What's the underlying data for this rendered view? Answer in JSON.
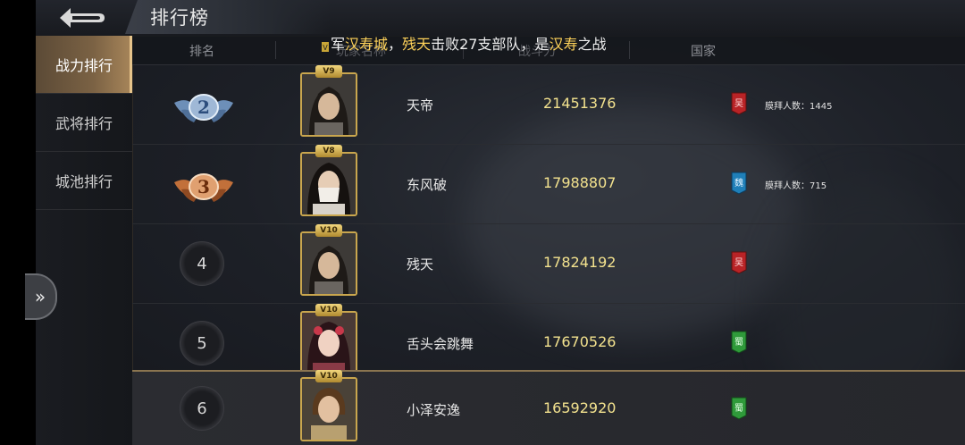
{
  "header": {
    "title": "排行榜"
  },
  "ticker": {
    "badge": "V",
    "p1": "军",
    "h1": "汉寿城",
    "p2": "，",
    "h2": "残天",
    "p3": "击败27支部队，是",
    "h3": "汉寿",
    "p4": "之战"
  },
  "sidebar": {
    "items": [
      {
        "label": "战力排行",
        "active": true
      },
      {
        "label": "武将排行",
        "active": false
      },
      {
        "label": "城池排行",
        "active": false
      }
    ]
  },
  "columns": [
    "排名",
    "玩家名称",
    "战斗力",
    "国家"
  ],
  "rows": [
    {
      "rank": "2",
      "vip": "V9",
      "name": "天帝",
      "power": "21451376",
      "country": "吴",
      "flag_color": "#b82326",
      "worship": "膜拜人数：1445"
    },
    {
      "rank": "3",
      "vip": "V8",
      "name": "东风破",
      "power": "17988807",
      "country": "魏",
      "flag_color": "#1f7fb8",
      "worship": "膜拜人数：715"
    },
    {
      "rank": "4",
      "vip": "V10",
      "name": "残天",
      "power": "17824192",
      "country": "吴",
      "flag_color": "#b82326",
      "worship": ""
    },
    {
      "rank": "5",
      "vip": "V10",
      "name": "舌头会跳舞",
      "power": "17670526",
      "country": "蜀",
      "flag_color": "#2f9a3a",
      "worship": ""
    },
    {
      "rank": "6",
      "vip": "V10",
      "name": "小泽安逸",
      "power": "16592920",
      "country": "蜀",
      "flag_color": "#2f9a3a",
      "worship": ""
    }
  ],
  "colors": {
    "accent": "#e6c48b",
    "power": "#f3e28e",
    "highlight": "#ffd35a"
  }
}
